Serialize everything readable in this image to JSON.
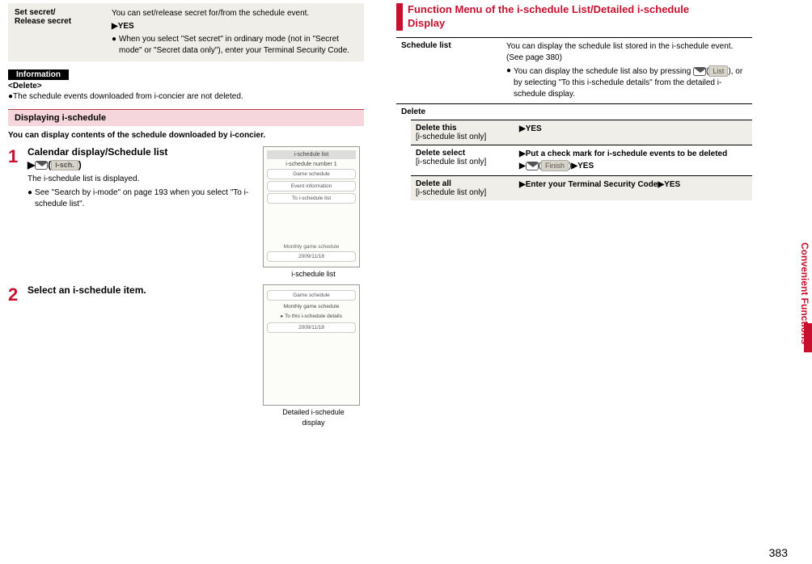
{
  "left": {
    "setSecret": {
      "label1": "Set secret/",
      "label2": "Release secret",
      "desc": "You can set/release secret for/from the schedule event.",
      "yes": "YES",
      "note": "When you select \"Set secret\" in ordinary mode (not in \"Secret mode\" or \"Secret data only\"), enter your Terminal Security Code."
    },
    "info": {
      "title": "Information",
      "deleteLabel": "<Delete>",
      "deleteNote": "The schedule events downloaded from i-concier are not deleted."
    },
    "displayHeading": "Displaying i-schedule",
    "displayIntro": "You can display contents of the schedule downloaded by i-concier.",
    "step1": {
      "num": "1",
      "title": "Calendar display/Schedule list",
      "softLabel": "i-sch.",
      "desc1": "The i-schedule list is displayed.",
      "desc2": "See \"Search by i-mode\" on page 193 when you select \"To i-schedule list\".",
      "mock": {
        "header": "i-schedule list",
        "num": "i-schedule number 1",
        "row1": "Game schedule",
        "row2": "Event information",
        "row3": "To i-schedule list",
        "footerTitle": "Monthly game schedule",
        "footerDate": "2009/11/18"
      },
      "caption": "i-schedule list"
    },
    "step2": {
      "num": "2",
      "title": "Select an i-schedule item.",
      "mock": {
        "row1": "Game schedule",
        "footerTitle": "Monthly game schedule",
        "row2": "To this i-schedule details",
        "footerDate": "2009/11/18"
      },
      "caption1": "Detailed i-schedule",
      "caption2": "display"
    }
  },
  "right": {
    "funcTitle1": "Function Menu of the i-schedule List/Detailed i-schedule",
    "funcTitle2": "Display",
    "scheduleList": {
      "label": "Schedule list",
      "desc1": "You can display the schedule list stored in the i-schedule event. (See page 380)",
      "desc2a": "You can display the schedule list also by pressing",
      "softLabel": "List",
      "desc2b": "), or by selecting \"To this i-schedule details\" from the detailed i-schedule display."
    },
    "deleteHeader": "Delete",
    "deleteThis": {
      "label": "Delete this",
      "sub": "[i-schedule list only]",
      "body": "YES"
    },
    "deleteSelect": {
      "label": "Delete select",
      "sub": "[i-schedule list only]",
      "body1": "Put a check mark for i-schedule events to be deleted",
      "softLabel": "Finish",
      "body2": "YES"
    },
    "deleteAll": {
      "label": "Delete all",
      "sub": "[i-schedule list only]",
      "body1": "Enter your Terminal Security Code",
      "body2": "YES"
    }
  },
  "sideTab": "Convenient Functions",
  "pageNum": "383"
}
